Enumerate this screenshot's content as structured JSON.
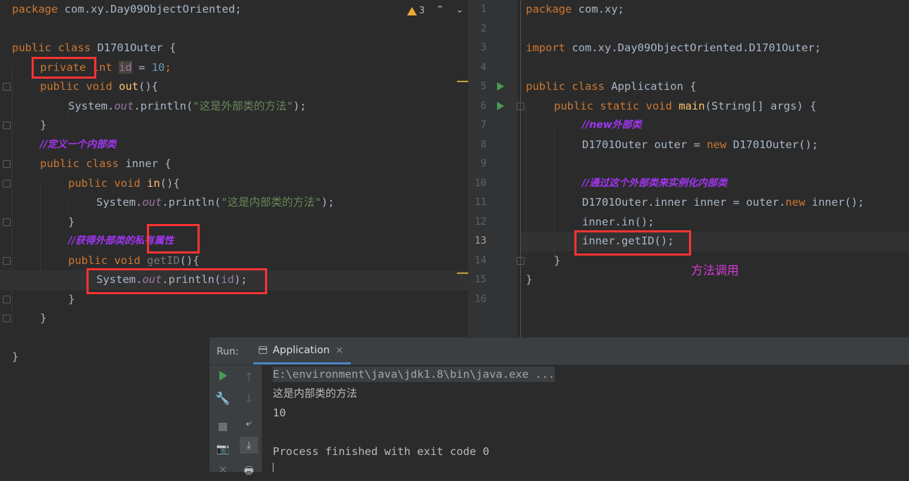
{
  "left_editor": {
    "warning_count": "3",
    "lines": {
      "l1_pkg": "package",
      "l1_rest": " com.xy.Day09ObjectOriented;",
      "l3_kw": "public class",
      "l3_rest": " D1701Outer {",
      "l4_private": "private",
      "l4_int": " int ",
      "l4_id": "id",
      "l4_eq": " = ",
      "l4_num": "10",
      "l4_semi": ";",
      "l5_kw": "public void",
      "l5_fn": "out",
      "l5_rest": "(){",
      "l6_sys": "System.",
      "l6_out": "out",
      "l6_p": ".println(",
      "l6_str": "\"这是外部类的方法\"",
      "l6_end": ");",
      "l7": "}",
      "l8_comment": "//定义一个内部类",
      "l9_kw": "public class",
      "l9_rest": " inner {",
      "l10_kw": "public void",
      "l10_fn": "in",
      "l10_rest": "(){",
      "l11_sys": "System.",
      "l11_out": "out",
      "l11_p": ".println(",
      "l11_str": "\"这是内部类的方法\"",
      "l11_end": ");",
      "l12": "}",
      "l13_comment": "//获得外部类的私有属性",
      "l14_kw": "public void",
      "l14_fn": "getID",
      "l14_rest": "(){",
      "l15_sys": "System.",
      "l15_out": "out",
      "l15_p": ".println(",
      "l15_id": "id",
      "l15_end": ");",
      "l16": "}",
      "l17": "}",
      "l19": "}"
    }
  },
  "right_editor": {
    "line_numbers": [
      "1",
      "2",
      "3",
      "4",
      "5",
      "6",
      "7",
      "8",
      "9",
      "10",
      "11",
      "12",
      "13",
      "14",
      "15",
      "16"
    ],
    "lines": {
      "r1_kw": "package",
      "r1_rest": " com.xy;",
      "r3_kw": "import",
      "r3_rest": " com.xy.Day09ObjectOriented.D1701Outer;",
      "r5_kw": "public class",
      "r5_rest": " Application {",
      "r6_kw": "public static void",
      "r6_fn": "main",
      "r6_rest": "(String[] args) {",
      "r7_comment": "//new外部类",
      "r8_a": "D1701Outer outer = ",
      "r8_new": "new",
      "r8_b": " D1701Outer();",
      "r10_comment": "//通过这个外部类来实例化内部类",
      "r11_a": "D1701Outer.inner inner = outer.",
      "r11_new": "new",
      "r11_b": " inner();",
      "r12": "inner.in();",
      "r13": "inner.getID();",
      "r14": "}",
      "r15": "}"
    },
    "annotation": "方法调用"
  },
  "run_panel": {
    "label": "Run:",
    "tab_label": "Application",
    "tab_close": "×",
    "output": {
      "cmd": "E:\\environment\\java\\jdk1.8\\bin\\java.exe ...",
      "line1": "这是内部类的方法",
      "line2": "10",
      "line3": "Process finished with exit code 0"
    },
    "icons": [
      "rerun-icon",
      "wrench-icon",
      "stop-icon",
      "camera-icon",
      "close-icon",
      "up-arrow-icon",
      "down-arrow-icon",
      "soft-wrap-icon",
      "scroll-to-end-icon",
      "print-icon"
    ]
  },
  "colors": {
    "keyword": "#cc7832",
    "string": "#6a8759",
    "number": "#6897bb",
    "field": "#9876aa",
    "method": "#ffc66d",
    "comment": "#a335f5",
    "highlight_box": "#ff3333",
    "annotation": "#d53bd6"
  }
}
